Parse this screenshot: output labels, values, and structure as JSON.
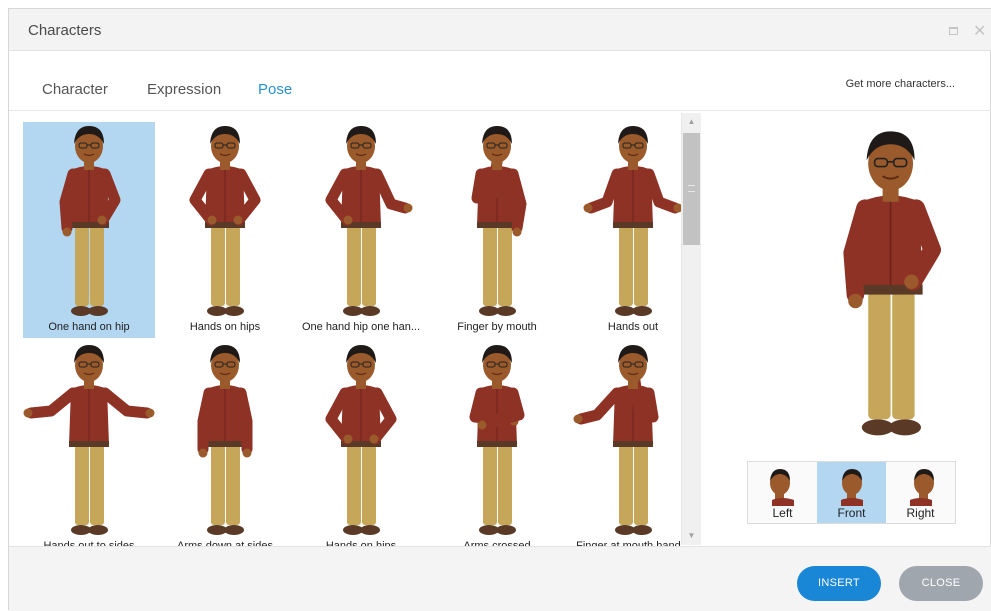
{
  "window": {
    "title": "Characters"
  },
  "tabs": [
    {
      "label": "Character"
    },
    {
      "label": "Expression"
    },
    {
      "label": "Pose"
    }
  ],
  "active_tab": "Pose",
  "more_link": "Get more characters...",
  "poses": [
    {
      "label": "One hand on hip",
      "pose": "one-hand-hip",
      "selected": true
    },
    {
      "label": "Hands on hips",
      "pose": "hands-hips"
    },
    {
      "label": "One hand hip one han...",
      "pose": "hip-and-out"
    },
    {
      "label": "Finger by mouth",
      "pose": "finger-mouth"
    },
    {
      "label": "Hands out",
      "pose": "hands-out"
    },
    {
      "label": "Hands out to sides",
      "pose": "hands-sides"
    },
    {
      "label": "Arms down at sides",
      "pose": "arms-down"
    },
    {
      "label": "Hands on hips",
      "pose": "hands-hips"
    },
    {
      "label": "Arms crossed",
      "pose": "arms-crossed"
    },
    {
      "label": "Finger at mouth hand...",
      "pose": "finger-mouth-hand"
    }
  ],
  "angles": [
    {
      "label": "Left"
    },
    {
      "label": "Front",
      "selected": true
    },
    {
      "label": "Right"
    }
  ],
  "buttons": {
    "insert": "INSERT",
    "close": "CLOSE"
  },
  "colors": {
    "accent": "#1a86d6",
    "selection": "#b3d6f1",
    "shirt": "#8e3226",
    "pants": "#c6a75a",
    "skin": "#9a5a2b",
    "hair": "#1f1a17",
    "shoes": "#5a3a26"
  }
}
